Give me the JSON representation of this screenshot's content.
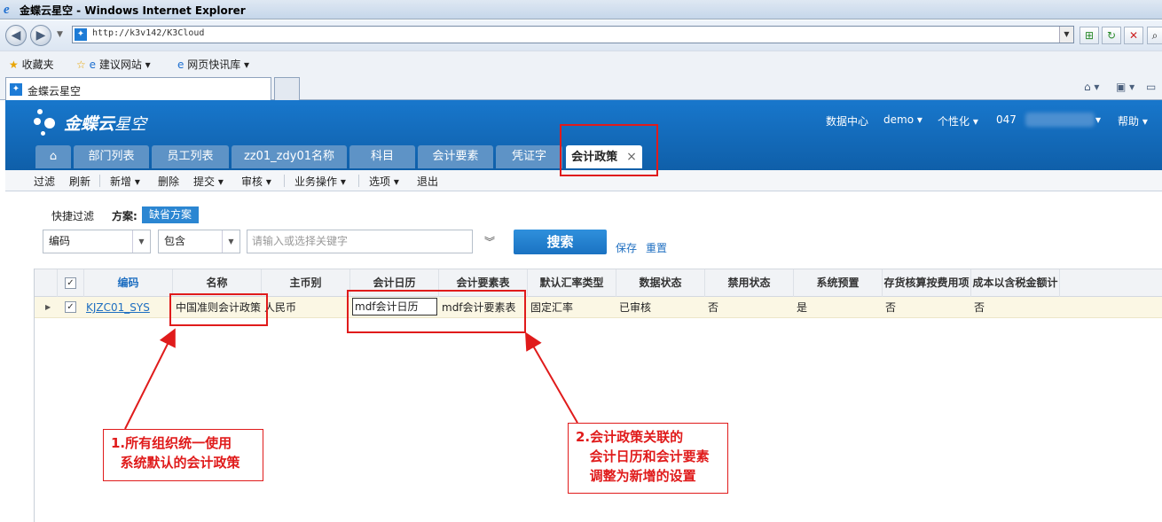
{
  "browser": {
    "title": "金蝶云星空 - Windows Internet Explorer",
    "url": "http://k3v142/K3Cloud",
    "favorites": [
      "收藏夹",
      "建议网站",
      "网页快讯库"
    ],
    "tab_title": "金蝶云星空"
  },
  "app": {
    "logo": "金蝶云",
    "logo_sub": "星空",
    "top_nav": [
      "数据中心",
      "demo",
      "个性化",
      "047",
      "帮助"
    ],
    "tabs": [
      "部门列表",
      "员工列表",
      "zz01_zdy01名称",
      "科目",
      "会计要素",
      "凭证字",
      "会计政策"
    ],
    "toolbar": [
      "过滤",
      "刷新",
      "新增",
      "删除",
      "提交",
      "审核",
      "业务操作",
      "选项",
      "退出"
    ]
  },
  "filter": {
    "quick_filter": "快捷过滤",
    "scheme_label": "方案:",
    "scheme_value": "缺省方案",
    "field": "编码",
    "operator": "包含",
    "keyword_placeholder": "请输入或选择关键字",
    "search": "搜索",
    "save": "保存",
    "reset": "重置"
  },
  "grid": {
    "headers": [
      "编码",
      "名称",
      "主币别",
      "会计日历",
      "会计要素表",
      "默认汇率类型",
      "数据状态",
      "禁用状态",
      "系统预置",
      "存货核算按费用项",
      "成本以含税金额计"
    ],
    "row": [
      "KJZC01_SYS",
      "中国准则会计政策",
      "人民币",
      "mdf会计日历",
      "mdf会计要素表",
      "固定汇率",
      "已审核",
      "否",
      "是",
      "否",
      "否"
    ]
  },
  "annotations": {
    "note1": "1.所有组织统一使用\n  系统默认的会计政策",
    "note2": "2.会计政策关联的\n   会计日历和会计要素\n   调整为新增的设置"
  },
  "colors": {
    "accent": "#1a72c2",
    "annotation": "#e01b1b",
    "header": "#1877cc"
  }
}
